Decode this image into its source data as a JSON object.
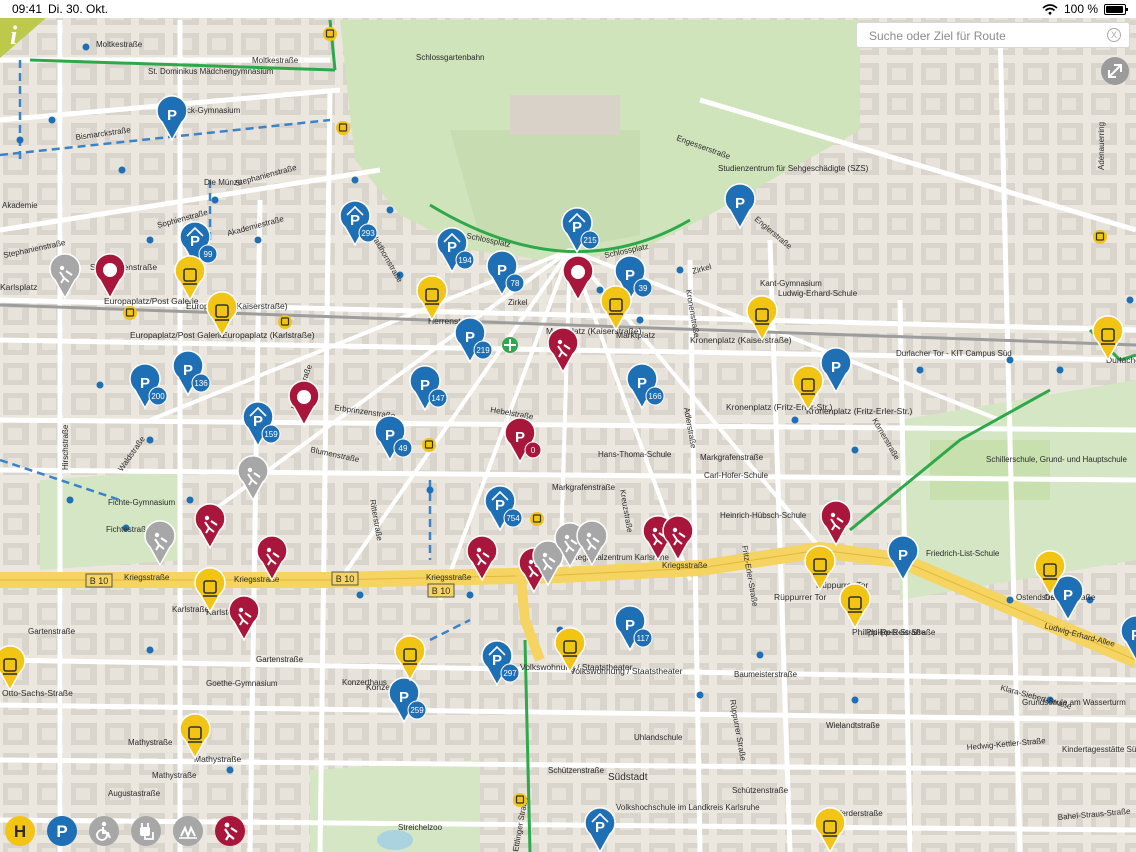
{
  "status_bar": {
    "time": "09:41",
    "date": "Di. 30. Okt.",
    "battery": "100 %"
  },
  "search": {
    "placeholder": "Suche oder Ziel für Route",
    "clear_icon": "close-circle-icon"
  },
  "controls": {
    "info_icon": "info-icon",
    "fullscreen_icon": "expand-icon"
  },
  "colors": {
    "parking": "#1f6fb5",
    "tram": "#f2c414",
    "construction": "#a8163b",
    "construction_inactive": "#a7a7a7",
    "primary_road": "#f5d462",
    "bike_route": "#2da84a",
    "park": "#cfe4bb",
    "building": "#d9d4cc"
  },
  "street_labels": [
    "Moltkestraße",
    "Moltkestraße",
    "Bismarckstraße",
    "Stephanienstraße",
    "Akademiestraße",
    "Stephanienstraße",
    "Hirschstraße",
    "Kriegsstraße",
    "Kriegsstraße",
    "Kriegsstraße",
    "Kriegsstraße",
    "Karlstraße",
    "Gartenstraße",
    "Gartenstraße",
    "Mathystraße",
    "Mathystraße",
    "Augustastraße",
    "Sophienstraße",
    "Erbprinzenstraße",
    "Blumenstraße",
    "Hebelstraße",
    "Markgrafenstraße",
    "Markgrafenstraße",
    "Zirkel",
    "Zirkel",
    "Schlossplatz",
    "Schlossplatz",
    "Engesserstraße",
    "Englerstraße",
    "Adenauerring",
    "Schützenstraße",
    "Schützenstraße",
    "Werderstraße",
    "Wielandtstraße",
    "Baumeisterstraße",
    "Philipp-Reis-Straße",
    "Ludwig-Erhard-Allee",
    "Ostendstraße",
    "Klara-Siebert-Straße",
    "Hedwig-Kettler-Straße",
    "Bahel-Straus-Straße",
    "Fichtestraße",
    "Waldstraße",
    "Ritterstraße",
    "Herrenstraße",
    "Kreuzstraße",
    "Adlerstraße",
    "Kronenstraße",
    "Ettlinger Straße",
    "Rüppurrer Straße",
    "Waldhornstraße",
    "Fritz-Erler-Straße",
    "Körnerstraße"
  ],
  "poi_labels": [
    "St. Dominikus Mädchengymnasium",
    "Bismarck-Gymnasium",
    "Die Münze",
    "Schlossgartenbahn",
    "Studienzentrum für Sehgeschädigte (SZS)",
    "Kant-Gymnasium",
    "Ludwig-Erhard-Schule",
    "Fichte-Gymnasium",
    "Hans-Thoma-Schule",
    "Carl-Hofer-Schule",
    "Heinrich-Hübsch-Schule",
    "Friedrich-List-Schule",
    "Schillerschule, Grund- und Hauptschule",
    "Goethe-Gymnasium",
    "Uhlandschule",
    "Südstadt",
    "Volkshochschule im Landkreis Karlsruhe",
    "Streichelzoo",
    "Grundschule am Wasserturm",
    "Kindertagesstätte Südstadtstrolche",
    "Akademie",
    "Durlacher Tor - KIT Campus Süd",
    "Regionalzentrum Karlsruhe",
    "Konzerthaus"
  ],
  "stop_labels": [
    "Europaplatz (Kaiserstraße)",
    "Europaplatz/Post Galerie",
    "Europaplatz (Karlstraße)",
    "Europaplatz/Post Galerie",
    "Herrenstraße",
    "Marktplatz (Kaiserstraße)",
    "Marktplatz",
    "Kronenplatz (Kaiserstraße)",
    "Kronenplatz (Fritz-Erler-Str.)",
    "Kronenplatz (Fritz-Erler-Str.)",
    "Durlacher Tor",
    "Karlstor",
    "Konzerthaus",
    "Volkswohnung / Staatstheater",
    "Volkswohnung / Staatstheater",
    "Rüppurrer Tor",
    "Rüppurrer Tor",
    "Philipp-Reis-Straße",
    "Ostendstraße",
    "Mathystraße",
    "Otto-Sachs-Straße",
    "Stephanienstraße",
    "Karlsplatz"
  ],
  "road_shields": [
    "B 10",
    "B 10",
    "B 10"
  ],
  "parking_counts": [
    "99",
    "293",
    "194",
    "78",
    "215",
    "39",
    "219",
    "147",
    "49",
    "166",
    "200",
    "136",
    "159",
    "754",
    "117",
    "297",
    "259",
    "0"
  ],
  "layer_toggles": [
    {
      "id": "stops",
      "label": "H",
      "icon": "stop-h-icon"
    },
    {
      "id": "parking",
      "label": "P",
      "icon": "parking-icon"
    },
    {
      "id": "accessibility",
      "label": "",
      "icon": "wheelchair-icon"
    },
    {
      "id": "charging",
      "label": "",
      "icon": "ev-charger-icon"
    },
    {
      "id": "bike",
      "label": "",
      "icon": "bikesharing-icon"
    },
    {
      "id": "construction",
      "label": "",
      "icon": "construction-icon"
    }
  ]
}
